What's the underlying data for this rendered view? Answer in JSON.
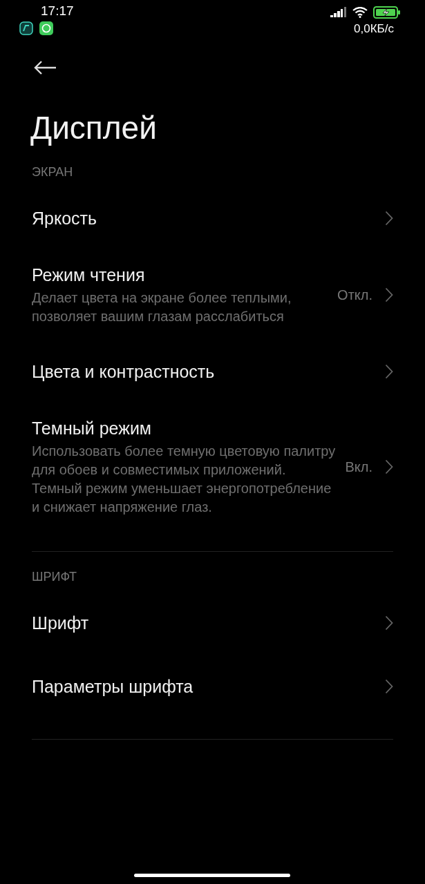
{
  "status_bar": {
    "time": "17:17",
    "net_speed": "0,0КБ/с"
  },
  "title": "Дисплей",
  "sections": [
    {
      "header": "ЭКРАН",
      "items": [
        {
          "label": "Яркость"
        },
        {
          "label": "Режим чтения",
          "description": "Делает цвета на экране более теплыми, позволяет вашим глазам расслабиться",
          "value": "Откл."
        },
        {
          "label": "Цвета и контрастность"
        },
        {
          "label": "Темный режим",
          "description": "Использовать более темную цветовую палитру для обоев и совместимых приложений. Темный режим уменьшает энергопотребление и снижает напряжение глаз.",
          "value": "Вкл."
        }
      ]
    },
    {
      "header": "ШРИФТ",
      "items": [
        {
          "label": "Шрифт"
        },
        {
          "label": "Параметры шрифта"
        }
      ]
    }
  ]
}
